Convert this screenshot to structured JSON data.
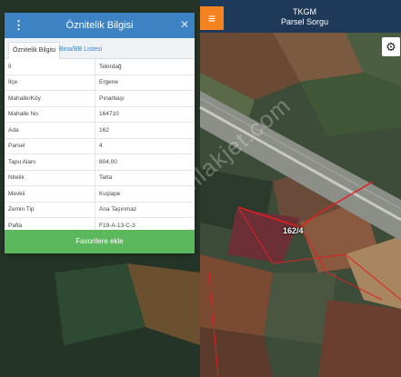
{
  "header": {
    "title": "TKGM",
    "subtitle": "Parsel Sorgu",
    "menu_icon": "hamburger-icon",
    "settings_icon": "gear-icon"
  },
  "dialog": {
    "title": "Öznitelik Bilgisi",
    "menu_icon": "vertical-dots-icon",
    "close_icon": "close-icon",
    "tabs": [
      {
        "label": "Öznitelik Bilgisi",
        "active": true
      },
      {
        "label": "Bina/BB Listesi",
        "active": false
      }
    ],
    "rows": [
      {
        "key": "İl",
        "value": "Tekirdağ"
      },
      {
        "key": "İlçe",
        "value": "Ergene"
      },
      {
        "key": "Mahalle/Köy",
        "value": "Pınarbaşı"
      },
      {
        "key": "Mahalle No",
        "value": "164710"
      },
      {
        "key": "Ada",
        "value": "162"
      },
      {
        "key": "Parsel",
        "value": "4"
      },
      {
        "key": "Tapu Alanı",
        "value": "804,00"
      },
      {
        "key": "Nitelik",
        "value": "Tarla"
      },
      {
        "key": "Mevkii",
        "value": "Kuşlape"
      },
      {
        "key": "Zemin Tip",
        "value": "Ana Taşınmaz"
      },
      {
        "key": "Pafta",
        "value": "F19-A-13-C-3"
      }
    ],
    "favorite_button": "Favorilere ekle"
  },
  "map": {
    "parcel_label": "162/4",
    "watermark": "emlakjet.com",
    "colors": {
      "accent": "#f58220",
      "header": "#1f3a59",
      "dialog_header": "#3d83c4",
      "button": "#5cb85c",
      "parcel_outline": "#e02020"
    }
  }
}
